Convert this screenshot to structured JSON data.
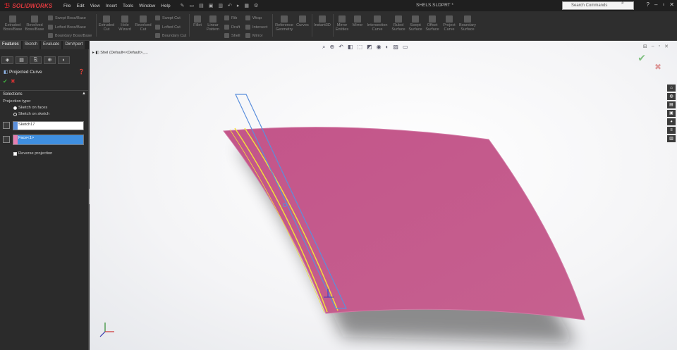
{
  "app": {
    "brand": "SOLIDWORKS",
    "doc_title": "SHELS.SLDPRT *"
  },
  "menu": [
    "File",
    "Edit",
    "View",
    "Insert",
    "Tools",
    "Window",
    "Help"
  ],
  "search": {
    "placeholder": "Search Commands"
  },
  "ribbon": {
    "features": [
      {
        "label": "Extruded Boss/Base"
      },
      {
        "label": "Revolved Boss/Base"
      },
      {
        "label": "Swept Boss/Base"
      },
      {
        "label": "Lofted Boss/Base"
      },
      {
        "label": "Boundary Boss/Base"
      },
      {
        "label": "Extruded Cut"
      },
      {
        "label": "Hole Wizard"
      },
      {
        "label": "Revolved Cut"
      },
      {
        "label": "Swept Cut"
      },
      {
        "label": "Lofted Cut"
      },
      {
        "label": "Boundary Cut"
      },
      {
        "label": "Fillet"
      },
      {
        "label": "Linear Pattern"
      },
      {
        "label": "Rib"
      },
      {
        "label": "Draft"
      },
      {
        "label": "Shell"
      },
      {
        "label": "Wrap"
      },
      {
        "label": "Intersect"
      },
      {
        "label": "Mirror"
      },
      {
        "label": "Reference Geometry"
      },
      {
        "label": "Curves"
      },
      {
        "label": "Instant3D"
      },
      {
        "label": "Mirror Entities"
      },
      {
        "label": "Mirror"
      },
      {
        "label": "Intersection Curve"
      },
      {
        "label": "Ruled Surface"
      },
      {
        "label": "Swept Surface"
      },
      {
        "label": "Offset Surface"
      },
      {
        "label": "Project Curve"
      },
      {
        "label": "Boundary Surface"
      }
    ]
  },
  "cmd_tabs": [
    "Features",
    "Sketch",
    "Evaluate",
    "DimXpert"
  ],
  "property_manager": {
    "title": "Projected Curve",
    "selections_header": "Selections",
    "projection_type_label": "Projection type:",
    "options": [
      "Sketch on faces",
      "Sketch on sketch"
    ],
    "selected_option": "Sketch on faces",
    "sketch_field": "Sketch17",
    "face_field": "Face<1>",
    "reverse_label": "Reverse projection",
    "reverse_checked": true
  },
  "viewport": {
    "tree_root": "Shel (Default<<Default>_...",
    "surface_color": "#c65a8e",
    "curve_color": "#f2df3a",
    "sketch_color": "#5b8fdc"
  }
}
